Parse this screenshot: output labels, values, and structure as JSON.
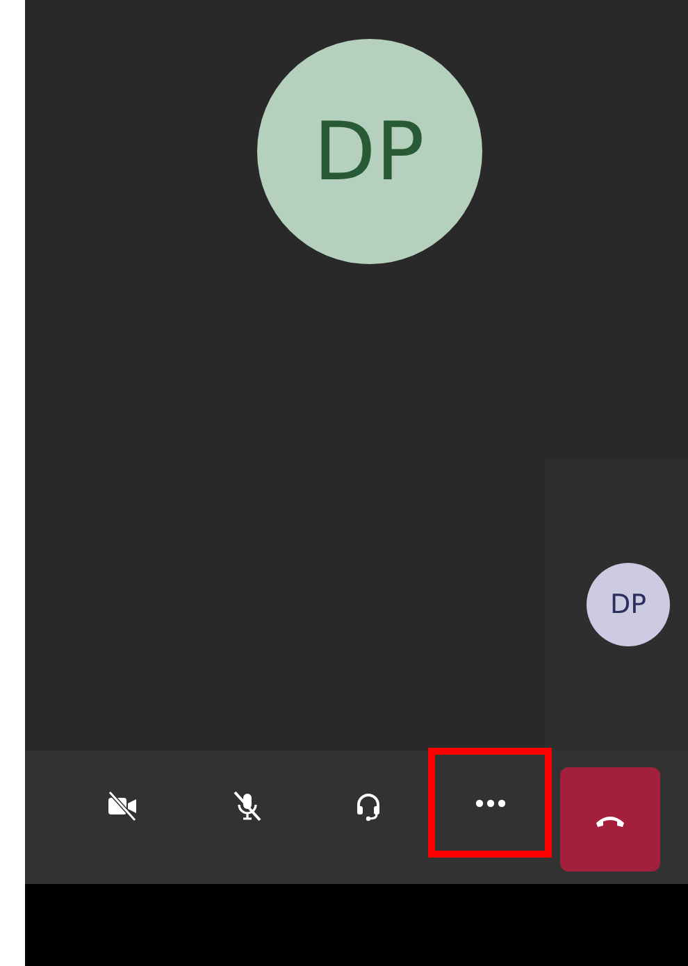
{
  "participant": {
    "initials": "DP"
  },
  "self_view": {
    "initials": "DP"
  },
  "toolbar": {
    "buttons": [
      {
        "kind": "camera",
        "muted": true,
        "highlighted": false
      },
      {
        "kind": "mic",
        "muted": true,
        "highlighted": false
      },
      {
        "kind": "audio",
        "highlighted": false
      },
      {
        "kind": "more",
        "highlighted": true
      },
      {
        "kind": "hangup",
        "highlighted": false
      }
    ]
  }
}
